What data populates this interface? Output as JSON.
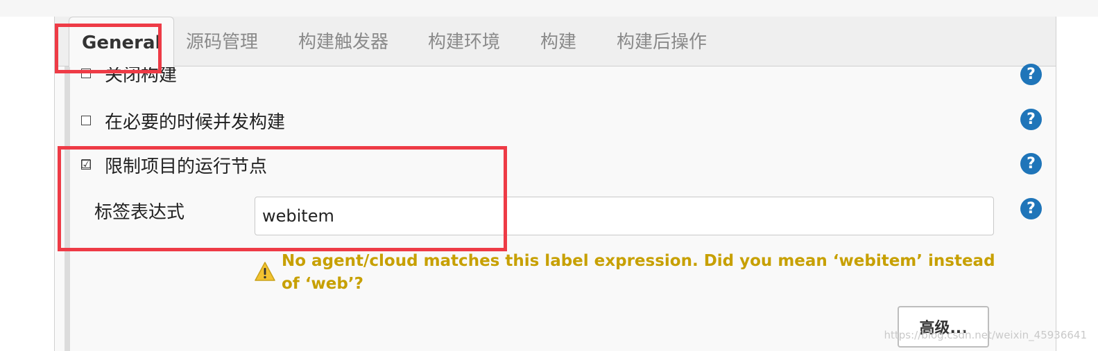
{
  "tabs": [
    {
      "label": "General",
      "active": true
    },
    {
      "label": "源码管理",
      "active": false
    },
    {
      "label": "构建触发器",
      "active": false
    },
    {
      "label": "构建环境",
      "active": false
    },
    {
      "label": "构建",
      "active": false
    },
    {
      "label": "构建后操作",
      "active": false
    }
  ],
  "options": [
    {
      "label": "关闭构建",
      "checked": false
    },
    {
      "label": "在必要的时候并发构建",
      "checked": false
    },
    {
      "label": "限制项目的运行节点",
      "checked": true
    }
  ],
  "label_expression": {
    "label": "标签表达式",
    "value": "webitem"
  },
  "warning": {
    "text": "No agent/cloud matches this label expression. Did you mean ‘webitem’ instead of ‘web’?"
  },
  "advanced_button": "高级...",
  "help_symbol": "?",
  "checkbox_checked_glyph": "☑",
  "watermark": "https://blog.csdn.net/weixin_45936641",
  "colors": {
    "highlight": "#ee3b46",
    "help": "#1f75b9",
    "warning_text": "#c7a000",
    "warning_icon": "#f2c230"
  }
}
